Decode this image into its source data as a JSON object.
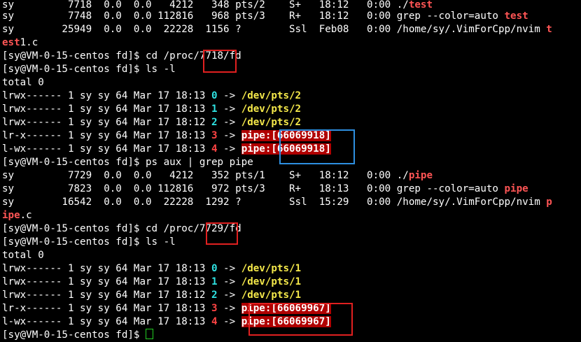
{
  "colors": {
    "background": "#000000",
    "text": "#ffffff",
    "match": "#ff5555",
    "link": "#f5e94a",
    "fd": "#2fe3e3",
    "pipe_bg": "#b00000",
    "annotation_red": "#e02020",
    "annotation_blue": "#2e8fe0"
  },
  "terminal": {
    "ps1": {
      "r1": {
        "a": "sy         7718  0.0  0.0   4212   348 pts/2    S+   18:12   0:00 ./",
        "m": "test"
      },
      "r2": {
        "a": "sy         7748  0.0  0.0 112816   968 pts/3    R+   18:12   0:00 grep --color=auto ",
        "m": "test"
      },
      "r3": {
        "a": "sy        25949  0.0  0.0  22228  1156 ?        Ssl  Feb08   0:00 /home/sy/.VimForCpp/nvim ",
        "m": "t"
      },
      "r4": {
        "m": "est",
        "b": "1.c"
      }
    },
    "cmd_cd1": {
      "a": "[sy@VM-0-15-centos fd]$ cd /proc/",
      "pid": "7718",
      "b": "/fd"
    },
    "cmd_ls1": "[sy@VM-0-15-centos fd]$ ls -l",
    "total1": "total 0",
    "fds1": [
      {
        "perm": "lrwx------ 1 sy sy 64 Mar 17 18:13 ",
        "fd": "0",
        "arrow": " -> ",
        "target": "/dev/pts/2"
      },
      {
        "perm": "lrwx------ 1 sy sy 64 Mar 17 18:13 ",
        "fd": "1",
        "arrow": " -> ",
        "target": "/dev/pts/2"
      },
      {
        "perm": "lrwx------ 1 sy sy 64 Mar 17 18:12 ",
        "fd": "2",
        "arrow": " -> ",
        "target": "/dev/pts/2"
      },
      {
        "perm": "lr-x------ 1 sy sy 64 Mar 17 18:13 ",
        "fd": "3",
        "arrow": " -> ",
        "target": "pipe:[66069918]"
      },
      {
        "perm": "l-wx------ 1 sy sy 64 Mar 17 18:13 ",
        "fd": "4",
        "arrow": " -> ",
        "target": "pipe:[66069918]"
      }
    ],
    "cmd_ps2": "[sy@VM-0-15-centos fd]$ ps aux | grep pipe",
    "ps2": {
      "r1": {
        "a": "sy         7729  0.0  0.0   4212   352 pts/1    S+   18:12   0:00 ./",
        "m": "pipe"
      },
      "r2": {
        "a": "sy         7823  0.0  0.0 112816   972 pts/3    R+   18:13   0:00 grep --color=auto ",
        "m": "pipe"
      },
      "r3": {
        "a": "sy        16542  0.0  0.0  22228  1292 ?        Ssl  15:29   0:00 /home/sy/.VimForCpp/nvim ",
        "m": "p"
      },
      "r4": {
        "m": "ipe",
        "b": ".c"
      }
    },
    "cmd_cd2": {
      "a": "[sy@VM-0-15-centos fd]$ cd /proc/",
      "pid": "7729",
      "b": "/fd"
    },
    "cmd_ls2": "[sy@VM-0-15-centos fd]$ ls -l",
    "total2": "total 0",
    "fds2": [
      {
        "perm": "lrwx------ 1 sy sy 64 Mar 17 18:13 ",
        "fd": "0",
        "arrow": " -> ",
        "target": "/dev/pts/1"
      },
      {
        "perm": "lrwx------ 1 sy sy 64 Mar 17 18:13 ",
        "fd": "1",
        "arrow": " -> ",
        "target": "/dev/pts/1"
      },
      {
        "perm": "lrwx------ 1 sy sy 64 Mar 17 18:12 ",
        "fd": "2",
        "arrow": " -> ",
        "target": "/dev/pts/1"
      },
      {
        "perm": "lr-x------ 1 sy sy 64 Mar 17 18:13 ",
        "fd": "3",
        "arrow": " -> ",
        "target": "pipe:[66069967]"
      },
      {
        "perm": "l-wx------ 1 sy sy 64 Mar 17 18:13 ",
        "fd": "4",
        "arrow": " -> ",
        "target": "pipe:[66069967]"
      }
    ],
    "prompt_partial": "[sy@VM-0-15-centos fd]$ "
  }
}
